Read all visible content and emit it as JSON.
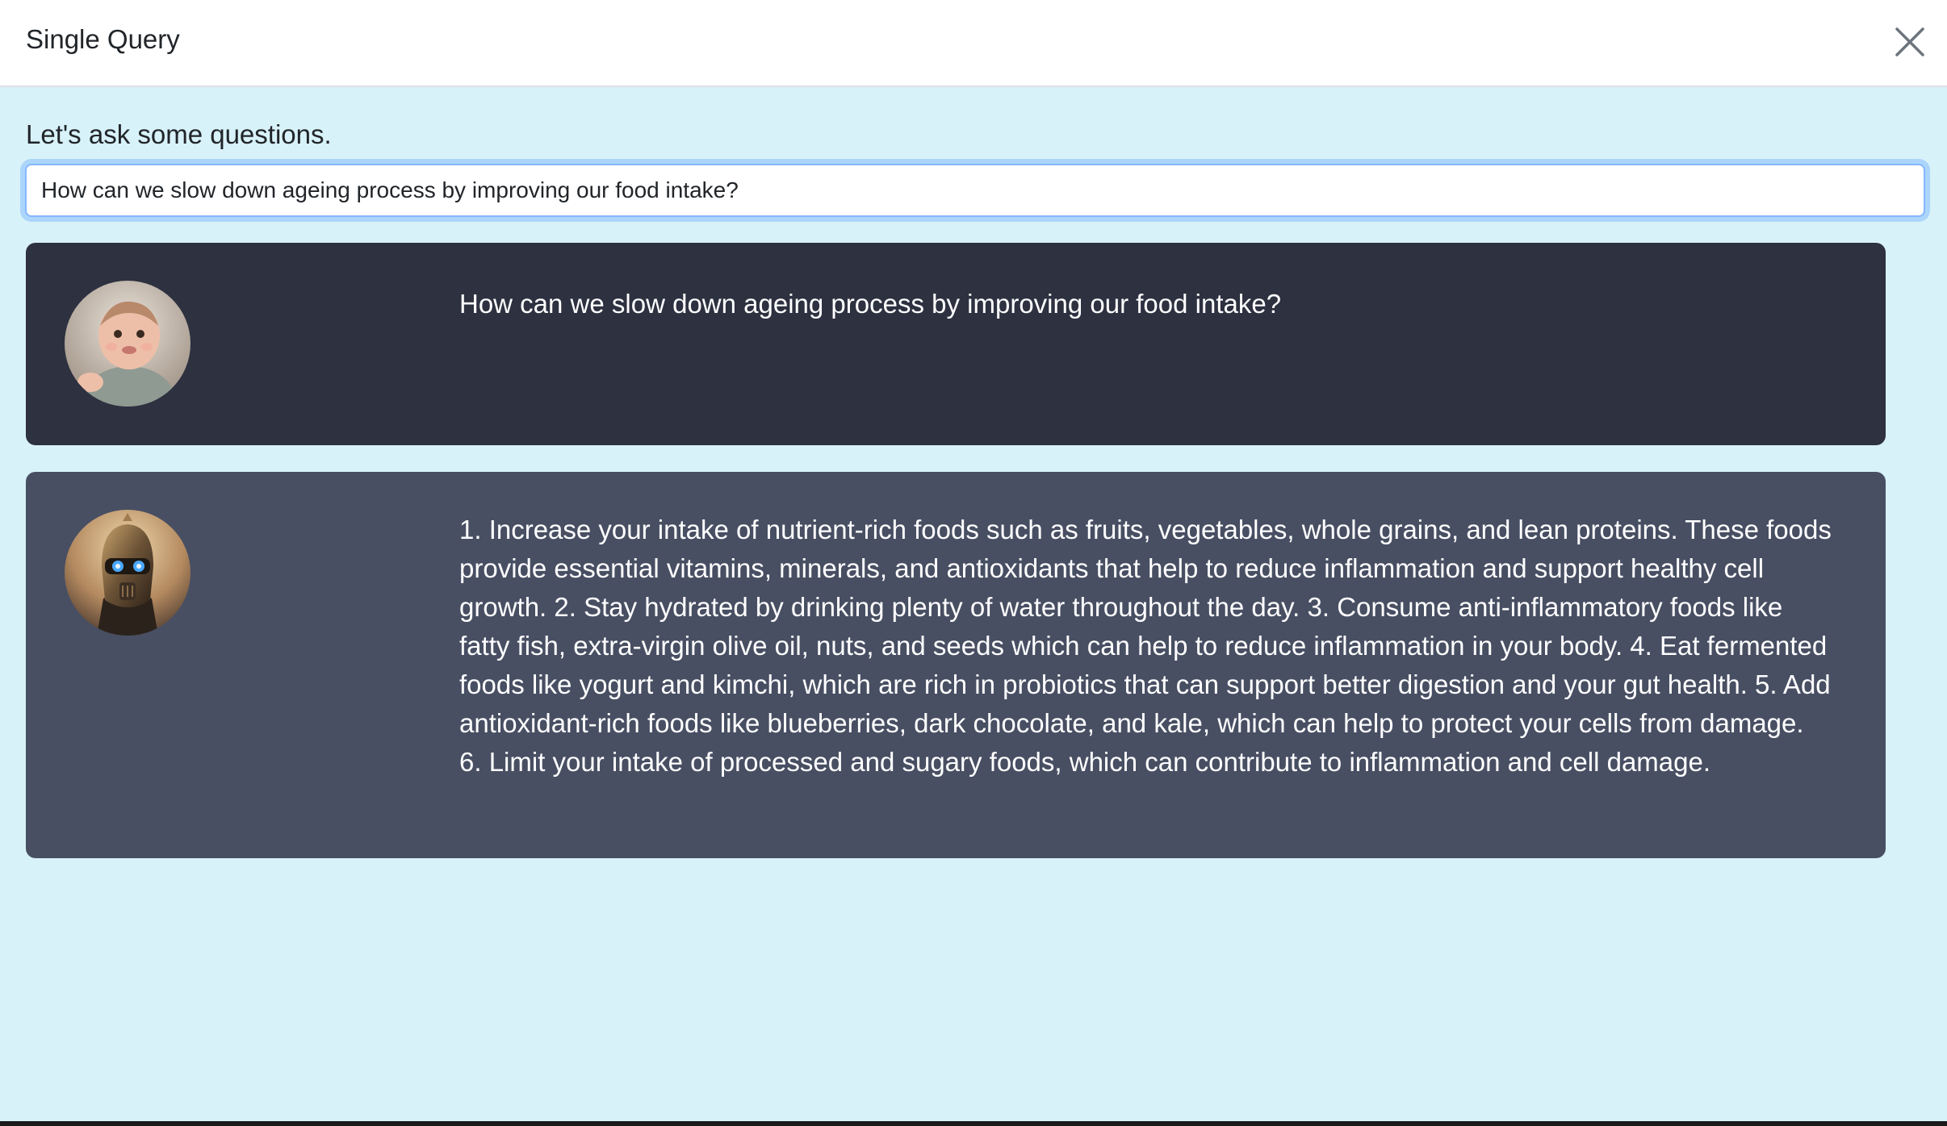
{
  "modal": {
    "title": "Single Query",
    "close_icon": "close-icon"
  },
  "prompt": {
    "label": "Let's ask some questions.",
    "input_value": "How can we slow down ageing process by improving our food intake?"
  },
  "conversation": [
    {
      "role": "user",
      "avatar": "baby-avatar",
      "text": "How can we slow down ageing process by improving our food intake?"
    },
    {
      "role": "assistant",
      "avatar": "robot-avatar",
      "text": "1. Increase your intake of nutrient-rich foods such as fruits, vegetables, whole grains, and lean proteins. These foods provide essential vitamins, minerals, and antioxidants that help to reduce inflammation and support healthy cell growth. 2. Stay hydrated by drinking plenty of water throughout the day. 3. Consume anti-inflammatory foods like fatty fish, extra-virgin olive oil, nuts, and seeds which can help to reduce inflammation in your body. 4. Eat fermented foods like yogurt and kimchi, which are rich in probiotics that can support better digestion and your gut health. 5. Add antioxidant-rich foods like blueberries, dark chocolate, and kale, which can help to protect your cells from damage. 6. Limit your intake of processed and sugary foods, which can contribute to inflammation and cell damage."
    }
  ],
  "colors": {
    "modal_bg": "#d8f2f9",
    "user_card_bg": "#2d3140",
    "assistant_card_bg": "#484f63",
    "input_focus_border": "#86b7fe"
  }
}
